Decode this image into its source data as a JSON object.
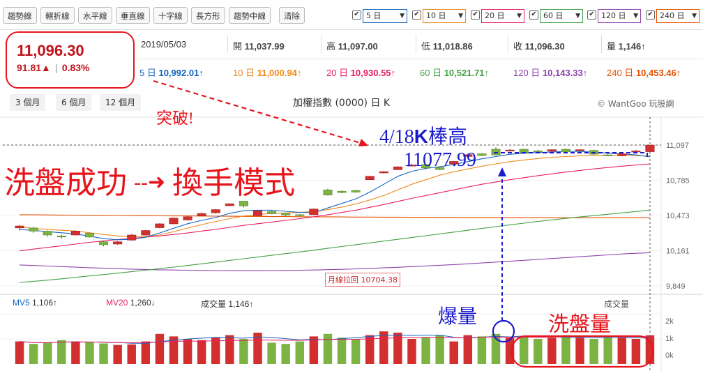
{
  "toolbar": {
    "tools": [
      "趨勢線",
      "轄折線",
      "水平線",
      "垂直線",
      "十字線",
      "長方形",
      "趨勢中線",
      "清除"
    ],
    "ma_selects": [
      {
        "label": "5 日",
        "color": "#1565c0"
      },
      {
        "label": "10 日",
        "color": "#ef8a1a"
      },
      {
        "label": "20 日",
        "color": "#e91e63"
      },
      {
        "label": "60 日",
        "color": "#43a047"
      },
      {
        "label": "120 日",
        "color": "#8e44ad"
      },
      {
        "label": "240 日",
        "color": "#e65100"
      }
    ],
    "check_mark": "✔"
  },
  "quote": {
    "price": "11,096.30",
    "change": "91.81▲",
    "change_pct": "0.83%",
    "date": "2019/05/03",
    "open_label": "開",
    "open": "11,037.99",
    "high_label": "高",
    "high": "11,097.00",
    "low_label": "低",
    "low": "11,018.86",
    "close_label": "收",
    "close": "11,096.30",
    "vol_label": "量",
    "vol": "1,146↑"
  },
  "ma_values": [
    {
      "label": "5 日",
      "value": "10,992.01↑",
      "color": "#1565c0"
    },
    {
      "label": "10 日",
      "value": "11,000.94↑",
      "color": "#ef8a1a"
    },
    {
      "label": "20 日",
      "value": "10,930.55↑",
      "color": "#e91e63"
    },
    {
      "label": "60 日",
      "value": "10,521.71↑",
      "color": "#43a047"
    },
    {
      "label": "120 日",
      "value": "10,143.33↑",
      "color": "#8e44ad"
    },
    {
      "label": "240 日",
      "value": "10,453.46↑",
      "color": "#e65100"
    }
  ],
  "ranges": [
    "3 個月",
    "6 個月",
    "12 個月"
  ],
  "chart_title": "加權指數 (0000) 日 K",
  "watermark": "© WantGoo 玩股網",
  "colors": {
    "up": "#d32f2f",
    "down": "#7cb342",
    "annotation": "#e8141c",
    "blue_ann": "#1a1acc"
  },
  "annotations": {
    "breakthrough": "突破!",
    "wash_success": "洗盤成功",
    "arrow": "--➜",
    "handover": "換手模式",
    "high_note_a": "4/18",
    "high_note_k": "K",
    "high_note_b": "棒高",
    "high_value": "11077.99",
    "burst": "爆量",
    "wash_vol": "洗盤量",
    "monthly_pullback": "月線拉回 10704.38"
  },
  "volume_panel": {
    "mv5_label": "MV5",
    "mv5": "1,106↑",
    "mv20_label": "MV20",
    "mv20": "1,260↓",
    "vol_label": "成交量",
    "vol": "1,146↑",
    "right_label": "成交量",
    "y_ticks": [
      "2k",
      "1k",
      "0k"
    ]
  },
  "chart_data": {
    "type": "candlestick",
    "title": "加權指數 (0000) 日 K",
    "y_ticks": [
      11097,
      10785,
      10473,
      10161,
      9849
    ],
    "ylim": [
      9849,
      11097
    ],
    "candles": [
      [
        10363,
        10380,
        10340,
        10385
      ],
      [
        10363,
        10334,
        10320,
        10372
      ],
      [
        10334,
        10300,
        10287,
        10340
      ],
      [
        10292,
        10285,
        10270,
        10302
      ],
      [
        10300,
        10335,
        10296,
        10340
      ],
      [
        10316,
        10282,
        10278,
        10320
      ],
      [
        10240,
        10214,
        10200,
        10250
      ],
      [
        10220,
        10240,
        10212,
        10247
      ],
      [
        10255,
        10300,
        10250,
        10310
      ],
      [
        10300,
        10340,
        10295,
        10345
      ],
      [
        10365,
        10399,
        10359,
        10405
      ],
      [
        10399,
        10450,
        10396,
        10455
      ],
      [
        10433,
        10462,
        10428,
        10472
      ],
      [
        10469,
        10490,
        10464,
        10500
      ],
      [
        10497,
        10525,
        10490,
        10530
      ],
      [
        10560,
        10577,
        10555,
        10580
      ],
      [
        10600,
        10558,
        10545,
        10602
      ],
      [
        10470,
        10514,
        10465,
        10520
      ],
      [
        10508,
        10488,
        10484,
        10514
      ],
      [
        10492,
        10477,
        10467,
        10496
      ],
      [
        10480,
        10478,
        10465,
        10484
      ],
      [
        10480,
        10530,
        10477,
        10535
      ],
      [
        10700,
        10654,
        10650,
        10710
      ],
      [
        10688,
        10676,
        10670,
        10695
      ],
      [
        10695,
        10680,
        10675,
        10700
      ],
      [
        10790,
        10820,
        10788,
        10825
      ],
      [
        10850,
        10861,
        10845,
        10867
      ],
      [
        10879,
        10904,
        10874,
        10910
      ],
      [
        10918,
        10920,
        10912,
        10931
      ],
      [
        10925,
        10894,
        10880,
        10930
      ],
      [
        10899,
        10880,
        10874,
        10905
      ],
      [
        10930,
        10952,
        10925,
        10958
      ],
      [
        10996,
        11012,
        10990,
        11020
      ],
      [
        11020,
        11004,
        10998,
        11025
      ],
      [
        11060,
        11010,
        11005,
        11077
      ],
      [
        11045,
        11053,
        11040,
        11060
      ],
      [
        11060,
        11030,
        11025,
        11065
      ],
      [
        11045,
        11040,
        11030,
        11055
      ],
      [
        11042,
        11056,
        11036,
        11060
      ],
      [
        11060,
        11038,
        11034,
        11066
      ],
      [
        11050,
        11056,
        11044,
        11060
      ],
      [
        11050,
        11016,
        11010,
        11056
      ],
      [
        11010,
        11008,
        11000,
        11025
      ],
      [
        11004,
        11020,
        10998,
        11028
      ],
      [
        11038,
        11045,
        11030,
        11055
      ],
      [
        11038,
        11096,
        11019,
        11097
      ]
    ],
    "ma5": [
      10350,
      10340,
      10330,
      10320,
      10310,
      10290,
      10268,
      10258,
      10262,
      10280,
      10318,
      10360,
      10400,
      10430,
      10455,
      10492,
      10515,
      10520,
      10520,
      10510,
      10500,
      10498,
      10540,
      10580,
      10620,
      10680,
      10750,
      10820,
      10865,
      10890,
      10905,
      10925,
      10950,
      10975,
      10995,
      11015,
      11025,
      11030,
      11035,
      11042,
      11040,
      11035,
      11025,
      11018,
      11010,
      10992
    ],
    "ma10": [
      10370,
      10360,
      10350,
      10342,
      10335,
      10320,
      10305,
      10292,
      10285,
      10288,
      10300,
      10330,
      10362,
      10392,
      10420,
      10445,
      10468,
      10482,
      10490,
      10495,
      10500,
      10508,
      10525,
      10548,
      10575,
      10610,
      10650,
      10700,
      10750,
      10790,
      10830,
      10860,
      10885,
      10910,
      10930,
      10950,
      10965,
      10978,
      10988,
      10995,
      11002,
      11005,
      11005,
      11002,
      11001,
      11001
    ],
    "ma20": [
      10160,
      10175,
      10190,
      10205,
      10220,
      10235,
      10248,
      10260,
      10270,
      10282,
      10292,
      10305,
      10318,
      10335,
      10350,
      10368,
      10385,
      10400,
      10415,
      10430,
      10445,
      10462,
      10480,
      10500,
      10520,
      10545,
      10570,
      10598,
      10625,
      10650,
      10675,
      10700,
      10725,
      10750,
      10770,
      10790,
      10808,
      10826,
      10842,
      10858,
      10872,
      10886,
      10898,
      10910,
      10920,
      10930
    ],
    "ma60": [
      9880,
      9890,
      9900,
      9912,
      9925,
      9938,
      9950,
      9962,
      9975,
      9988,
      10002,
      10016,
      10030,
      10045,
      10060,
      10075,
      10090,
      10105,
      10120,
      10135,
      10150,
      10166,
      10182,
      10198,
      10214,
      10230,
      10246,
      10262,
      10278,
      10294,
      10310,
      10326,
      10342,
      10358,
      10374,
      10390,
      10405,
      10420,
      10434,
      10447,
      10460,
      10472,
      10484,
      10496,
      10508,
      10521
    ],
    "ma120": [
      10035,
      10030,
      10025,
      10020,
      10015,
      10010,
      10006,
      10002,
      9998,
      9995,
      9992,
      9990,
      9988,
      9986,
      9985,
      9984,
      9984,
      9984,
      9985,
      9986,
      9988,
      9990,
      9993,
      9996,
      10000,
      10004,
      10009,
      10014,
      10020,
      10026,
      10032,
      10038,
      10045,
      10052,
      10060,
      10068,
      10076,
      10084,
      10092,
      10100,
      10108,
      10116,
      10124,
      10132,
      10138,
      10143
    ],
    "ma240": [
      10480,
      10479,
      10478,
      10477,
      10476,
      10475,
      10474,
      10473,
      10472,
      10471,
      10470,
      10469,
      10469,
      10468,
      10467,
      10466,
      10465,
      10465,
      10464,
      10463,
      10462,
      10461,
      10461,
      10460,
      10459,
      10459,
      10458,
      10458,
      10457,
      10457,
      10456,
      10456,
      10455,
      10455,
      10455,
      10454,
      10454,
      10454,
      10454,
      10453,
      10453,
      10453,
      10453,
      10453,
      10453,
      10453
    ],
    "volume": [
      900,
      800,
      850,
      950,
      900,
      870,
      820,
      760,
      780,
      900,
      1200,
      1100,
      1000,
      950,
      1050,
      1150,
      1000,
      1250,
      850,
      800,
      900,
      1100,
      1200,
      1050,
      1000,
      1150,
      1300,
      1250,
      1000,
      1050,
      1150,
      900,
      1150,
      1100,
      1200,
      1050,
      1100,
      1000,
      1050,
      1150,
      1050,
      1000,
      1100,
      1050,
      1000,
      1146
    ],
    "volume_up": [
      true,
      false,
      false,
      false,
      true,
      false,
      false,
      true,
      true,
      true,
      true,
      true,
      true,
      true,
      true,
      true,
      false,
      true,
      false,
      false,
      false,
      true,
      false,
      false,
      false,
      true,
      true,
      true,
      true,
      false,
      false,
      true,
      true,
      false,
      false,
      true,
      false,
      false,
      true,
      false,
      true,
      false,
      false,
      true,
      true,
      true
    ],
    "volume_ylim": [
      0,
      2000
    ]
  }
}
